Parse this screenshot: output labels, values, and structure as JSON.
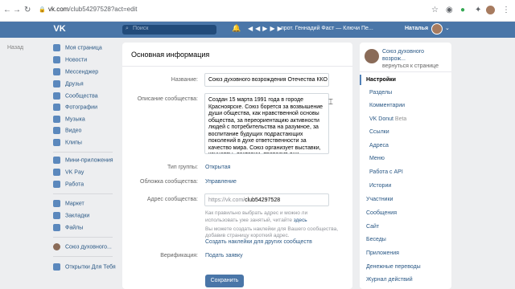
{
  "browser": {
    "host": "vk.com",
    "path": "/club54297528?act=edit"
  },
  "header": {
    "search_placeholder": "Поиск",
    "track": "прот. Геннадий Фаст — Ключи Пе...",
    "user_name": "Наталья"
  },
  "back_label": "Назад",
  "sidebar": {
    "items": [
      {
        "label": "Моя страница",
        "icon": "home-icon"
      },
      {
        "label": "Новости",
        "icon": "news-icon"
      },
      {
        "label": "Мессенджер",
        "icon": "messenger-icon"
      },
      {
        "label": "Друзья",
        "icon": "friends-icon"
      },
      {
        "label": "Сообщества",
        "icon": "communities-icon"
      },
      {
        "label": "Фотографии",
        "icon": "photos-icon"
      },
      {
        "label": "Музыка",
        "icon": "music-icon"
      },
      {
        "label": "Видео",
        "icon": "video-icon"
      },
      {
        "label": "Клипы",
        "icon": "clips-icon"
      },
      {
        "label": "Мини-приложения",
        "icon": "mini-apps-icon"
      },
      {
        "label": "VK Pay",
        "icon": "vkpay-icon"
      },
      {
        "label": "Работа",
        "icon": "work-icon"
      },
      {
        "label": "Маркет",
        "icon": "market-icon"
      },
      {
        "label": "Закладки",
        "icon": "bookmarks-icon"
      },
      {
        "label": "Файлы",
        "icon": "files-icon"
      },
      {
        "label": "Союз духовного...",
        "icon": "group-avatar-icon"
      },
      {
        "label": "Открытки Для Тебя",
        "icon": "app-icon"
      }
    ]
  },
  "main": {
    "title": "Основная информация",
    "name_label": "Название:",
    "name_value": "Союз духовного возрождения Отечества ККО",
    "desc_label": "Описание сообщества:",
    "desc_value": "Создан 15 марта 1991 года в городе Красноярске. Союз борется за возвышение души общества, как нравственной основы общества, за переориентацию активности людей с потребительства на разумное, за воспитание будущих подрастающих поколений в духе ответственности за качество мира. Союз организует выставки, концерты, лектории, проводит дни духовности и культуры.",
    "group_type_label": "Тип группы:",
    "group_type_value": "Открытая",
    "cover_label": "Обложка сообщества:",
    "cover_value": "Управление",
    "address_label": "Адрес сообщества:",
    "address_prefix": "https://vk.com/",
    "address_value": "club54297528",
    "hint1": "Как правильно выбрать адрес и можно ли",
    "hint2": "использовать уже занятый, читайте",
    "hint2_link": "здесь",
    "hint3": "Вы можете создать наклейки для Вашего сообщества,",
    "hint4": "добавив страницу короткий адрес.",
    "stickers_link": "Создать наклейки для других сообществ",
    "verification_label": "Верификация:",
    "verification_value": "Подать заявку",
    "save_label": "Сохранить"
  },
  "right": {
    "group_title": "Союз духовного возрож...",
    "back_to_page": "вернуться к странице",
    "nav": [
      {
        "label": "Настройки",
        "active": true,
        "sub": false
      },
      {
        "label": "Разделы",
        "active": false,
        "sub": true
      },
      {
        "label": "Комментарии",
        "active": false,
        "sub": true
      },
      {
        "label": "VK Donut",
        "active": false,
        "sub": true,
        "badge": "Beta"
      },
      {
        "label": "Ссылки",
        "active": false,
        "sub": true
      },
      {
        "label": "Адреса",
        "active": false,
        "sub": true
      },
      {
        "label": "Меню",
        "active": false,
        "sub": true
      },
      {
        "label": "Работа с API",
        "active": false,
        "sub": true
      },
      {
        "label": "Истории",
        "active": false,
        "sub": true
      },
      {
        "label": "Участники",
        "active": false,
        "sub": false
      },
      {
        "label": "Сообщения",
        "active": false,
        "sub": false
      },
      {
        "label": "Сайт",
        "active": false,
        "sub": false
      },
      {
        "label": "Беседы",
        "active": false,
        "sub": false
      },
      {
        "label": "Приложения",
        "active": false,
        "sub": false
      },
      {
        "label": "Денежные переводы",
        "active": false,
        "sub": false
      },
      {
        "label": "Журнал действий",
        "active": false,
        "sub": false
      }
    ]
  }
}
